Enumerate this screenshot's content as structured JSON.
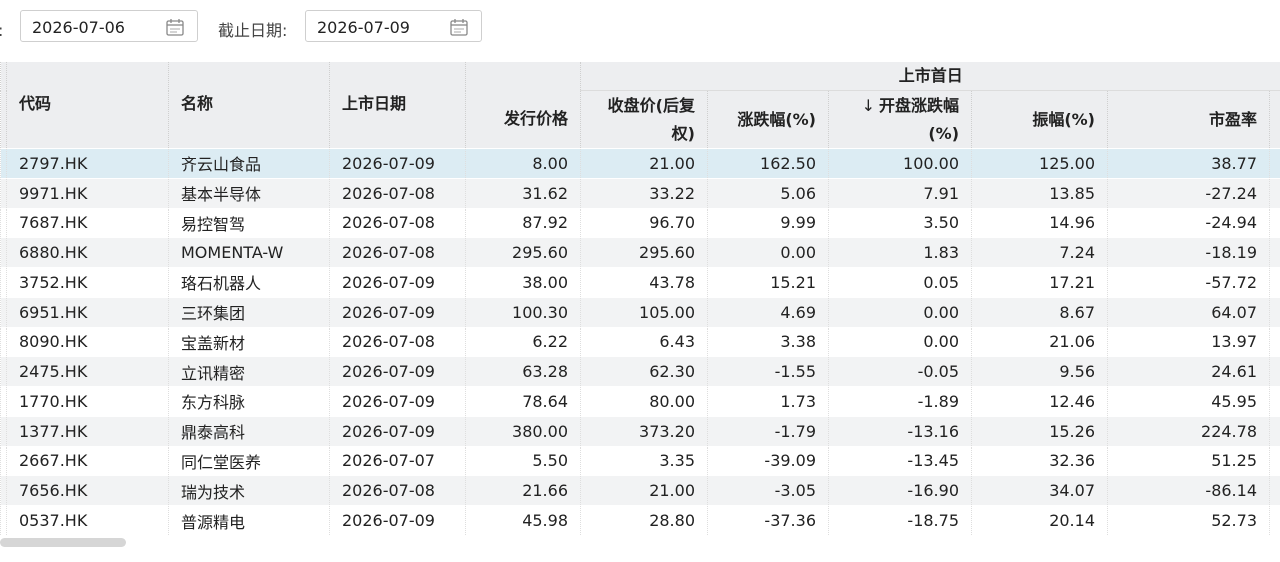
{
  "filters": {
    "start_label_fragment": "期:",
    "start_date": "2026-07-06",
    "end_label": "截止日期:",
    "end_date": "2026-07-09",
    "icon": "calendar-icon"
  },
  "table": {
    "group_header": "上市首日",
    "columns": {
      "code": "代码",
      "name": "名称",
      "listing_date": "上市日期",
      "issue_price": "发行价格",
      "close_price": "收盘价(后复权)",
      "change_pct": "涨跌幅(%)",
      "open_change_pct": "开盘涨跌幅(%)",
      "amplitude": "振幅(%)",
      "pe": "市盈率"
    },
    "sort": {
      "column": "open_change_pct",
      "direction": "desc",
      "glyph": "↓"
    },
    "selected_row": 0,
    "rows": [
      {
        "code": "2797.HK",
        "name": "齐云山食品",
        "date": "2026-07-09",
        "issue": "8.00",
        "close": "21.00",
        "chg": "162.50",
        "open": "100.00",
        "amp": "125.00",
        "pe": "38.77"
      },
      {
        "code": "9971.HK",
        "name": "基本半导体",
        "date": "2026-07-08",
        "issue": "31.62",
        "close": "33.22",
        "chg": "5.06",
        "open": "7.91",
        "amp": "13.85",
        "pe": "-27.24"
      },
      {
        "code": "7687.HK",
        "name": "易控智驾",
        "date": "2026-07-08",
        "issue": "87.92",
        "close": "96.70",
        "chg": "9.99",
        "open": "3.50",
        "amp": "14.96",
        "pe": "-24.94"
      },
      {
        "code": "6880.HK",
        "name": "MOMENTA-W",
        "date": "2026-07-08",
        "issue": "295.60",
        "close": "295.60",
        "chg": "0.00",
        "open": "1.83",
        "amp": "7.24",
        "pe": "-18.19"
      },
      {
        "code": "3752.HK",
        "name": "珞石机器人",
        "date": "2026-07-09",
        "issue": "38.00",
        "close": "43.78",
        "chg": "15.21",
        "open": "0.05",
        "amp": "17.21",
        "pe": "-57.72"
      },
      {
        "code": "6951.HK",
        "name": "三环集团",
        "date": "2026-07-09",
        "issue": "100.30",
        "close": "105.00",
        "chg": "4.69",
        "open": "0.00",
        "amp": "8.67",
        "pe": "64.07"
      },
      {
        "code": "8090.HK",
        "name": "宝盖新材",
        "date": "2026-07-08",
        "issue": "6.22",
        "close": "6.43",
        "chg": "3.38",
        "open": "0.00",
        "amp": "21.06",
        "pe": "13.97"
      },
      {
        "code": "2475.HK",
        "name": "立讯精密",
        "date": "2026-07-09",
        "issue": "63.28",
        "close": "62.30",
        "chg": "-1.55",
        "open": "-0.05",
        "amp": "9.56",
        "pe": "24.61"
      },
      {
        "code": "1770.HK",
        "name": "东方科脉",
        "date": "2026-07-09",
        "issue": "78.64",
        "close": "80.00",
        "chg": "1.73",
        "open": "-1.89",
        "amp": "12.46",
        "pe": "45.95"
      },
      {
        "code": "1377.HK",
        "name": "鼎泰高科",
        "date": "2026-07-09",
        "issue": "380.00",
        "close": "373.20",
        "chg": "-1.79",
        "open": "-13.16",
        "amp": "15.26",
        "pe": "224.78"
      },
      {
        "code": "2667.HK",
        "name": "同仁堂医养",
        "date": "2026-07-07",
        "issue": "5.50",
        "close": "3.35",
        "chg": "-39.09",
        "open": "-13.45",
        "amp": "32.36",
        "pe": "51.25"
      },
      {
        "code": "7656.HK",
        "name": "瑞为技术",
        "date": "2026-07-08",
        "issue": "21.66",
        "close": "21.00",
        "chg": "-3.05",
        "open": "-16.90",
        "amp": "34.07",
        "pe": "-86.14"
      },
      {
        "code": "0537.HK",
        "name": "普源精电",
        "date": "2026-07-09",
        "issue": "45.98",
        "close": "28.80",
        "chg": "-37.36",
        "open": "-18.75",
        "amp": "20.14",
        "pe": "52.73"
      }
    ]
  },
  "scrollbar": {
    "horizontal_position": 0
  }
}
